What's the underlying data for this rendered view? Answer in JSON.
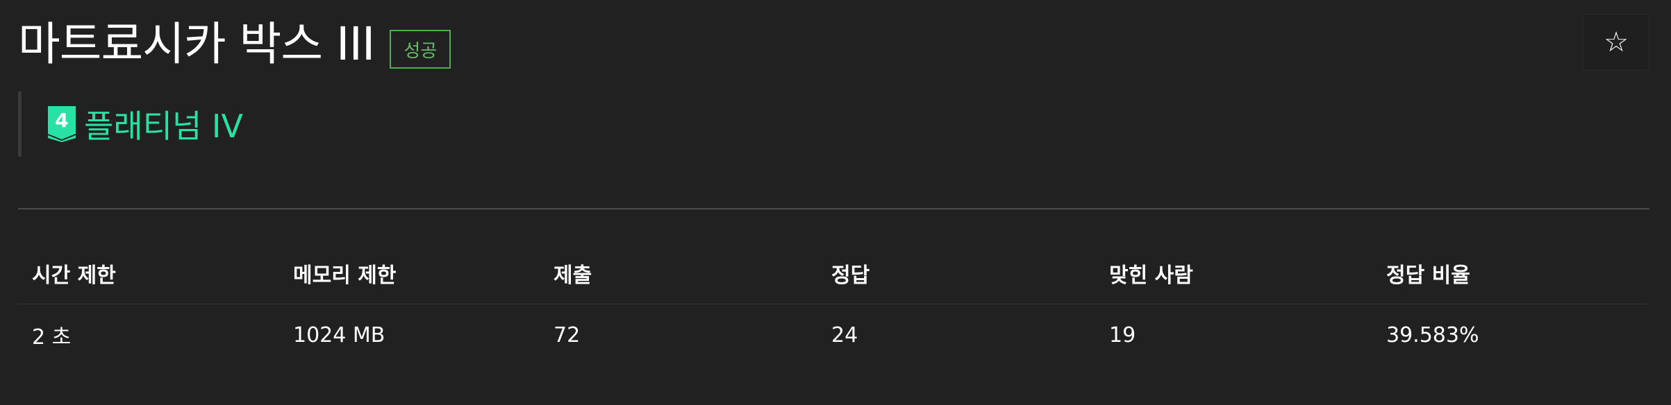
{
  "problem": {
    "title": "마트료시카 박스 III",
    "result_badge": "성공",
    "tier": {
      "label": "플래티넘 IV",
      "level_number": "4",
      "color": "#27e2a4"
    }
  },
  "actions": {
    "star_icon": "☆"
  },
  "info_table": {
    "headers": [
      "시간 제한",
      "메모리 제한",
      "제출",
      "정답",
      "맞힌 사람",
      "정답 비율"
    ],
    "values": [
      "2 초",
      "1024 MB",
      "72",
      "24",
      "19",
      "39.583%"
    ]
  },
  "colors": {
    "background": "#212121",
    "success": "#4caf50",
    "tier_accent": "#27e2a4"
  }
}
